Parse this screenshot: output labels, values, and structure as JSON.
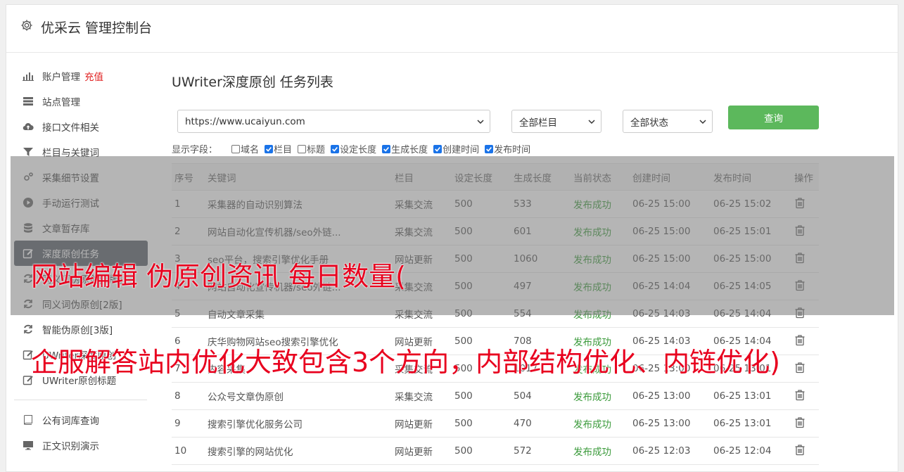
{
  "app": {
    "title": "优采云 管理控制台"
  },
  "sidebar": {
    "items": [
      {
        "label": "账户管理",
        "extra": "充值",
        "icon": "bar-chart-icon"
      },
      {
        "label": "站点管理",
        "icon": "server-icon"
      },
      {
        "label": "接口文件相关",
        "icon": "cloud-upload-icon"
      },
      {
        "label": "栏目与关键词",
        "icon": "filter-icon"
      },
      {
        "label": "采集细节设置",
        "icon": "gears-icon"
      },
      {
        "label": "手动运行测试",
        "icon": "play-icon"
      },
      {
        "label": "文章暂存库",
        "icon": "database-icon"
      },
      {
        "label": "深度原创任务",
        "icon": "edit-icon",
        "active": true
      },
      {
        "label": "同义词伪原创[1版]",
        "icon": "refresh-icon"
      },
      {
        "label": "同义词伪原创[2版]",
        "icon": "refresh-icon"
      },
      {
        "label": "智能伪原创[3版]",
        "icon": "refresh-icon"
      },
      {
        "label": "UWriter深度原创",
        "icon": "edit-icon"
      },
      {
        "label": "UWriter原创标题",
        "icon": "edit-icon"
      }
    ],
    "items2": [
      {
        "label": "公有词库查询",
        "icon": "book-icon"
      },
      {
        "label": "正文识别演示",
        "icon": "monitor-icon"
      }
    ]
  },
  "main": {
    "title": "UWriter深度原创 任务列表",
    "site_select": "https://www.ucaiyun.com",
    "column_select": "全部栏目",
    "status_select": "全部状态",
    "query_label": "查询",
    "fields_label": "显示字段：",
    "fields": [
      {
        "label": "域名",
        "checked": false
      },
      {
        "label": "栏目",
        "checked": true
      },
      {
        "label": "标题",
        "checked": false
      },
      {
        "label": "设定长度",
        "checked": true
      },
      {
        "label": "生成长度",
        "checked": true
      },
      {
        "label": "创建时间",
        "checked": true
      },
      {
        "label": "发布时间",
        "checked": true
      }
    ],
    "table": {
      "headers": [
        "序号",
        "关键词",
        "栏目",
        "设定长度",
        "生成长度",
        "当前状态",
        "创建时间",
        "发布时间",
        "操作"
      ],
      "rows": [
        [
          "1",
          "采集器的自动识别算法",
          "采集交流",
          "500",
          "533",
          "发布成功",
          "06-25 15:00",
          "06-25 15:02"
        ],
        [
          "2",
          "网站自动化宣传机器/seo外链...",
          "采集交流",
          "500",
          "601",
          "发布成功",
          "06-25 15:00",
          "06-25 15:01"
        ],
        [
          "3",
          "seo平台，搜索引擎优化手册",
          "网站更新",
          "500",
          "1060",
          "发布成功",
          "06-25 15:00",
          "06-25 15:00"
        ],
        [
          "4",
          "网站自动化宣传机器/seo外链...",
          "采集交流",
          "500",
          "497",
          "发布成功",
          "06-25 14:04",
          "06-25 14:05"
        ],
        [
          "5",
          "自动文章采集",
          "采集交流",
          "500",
          "554",
          "发布成功",
          "06-25 14:03",
          "06-25 14:04"
        ],
        [
          "6",
          "庆华购物网站seo搜索引擎优化",
          "网站更新",
          "500",
          "708",
          "发布成功",
          "06-25 14:03",
          "06-25 14:04"
        ],
        [
          "7",
          "内容采集",
          "采集交流",
          "500",
          "1017",
          "发布成功",
          "06-25 13:00",
          "06-25 13:01"
        ],
        [
          "8",
          "公众号文章伪原创",
          "采集交流",
          "500",
          "504",
          "发布成功",
          "06-25 13:00",
          "06-25 13:01"
        ],
        [
          "9",
          "搜索引擎优化服务公司",
          "网站更新",
          "500",
          "470",
          "发布成功",
          "06-25 13:00",
          "06-25 13:01"
        ],
        [
          "10",
          "搜索引擎的网站优化",
          "网站更新",
          "500",
          "572",
          "发布成功",
          "06-25 12:03",
          "06-25 12:04"
        ]
      ]
    }
  },
  "overlay_caption": {
    "line1": "网站编辑 伪原创资讯 每日数量(",
    "line2": "企服解答站内优化大致包含3个方向，内部结构优化、内链优化)"
  },
  "colors": {
    "accent_green": "#5cb85c",
    "active_nav": "#585d66",
    "caption_red": "#e8001e",
    "status_green": "#3a9a3a",
    "recharge_red": "#e02020"
  }
}
